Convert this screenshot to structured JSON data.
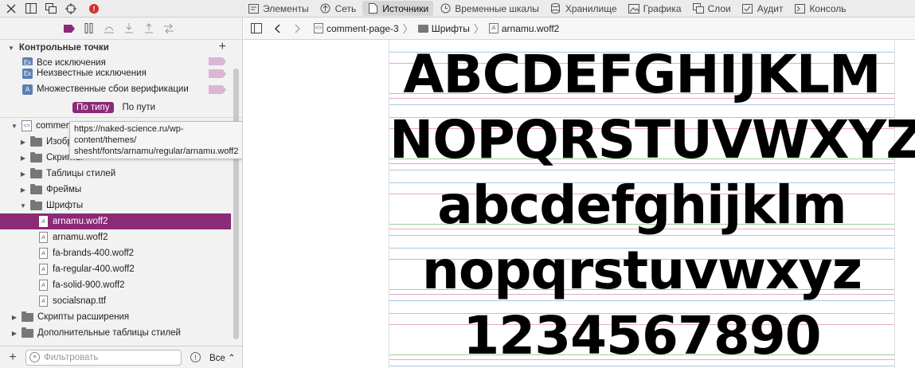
{
  "toolbar": {
    "icons": [
      "close-icon",
      "dock-icon",
      "undock-icon",
      "crosshair-icon"
    ],
    "error_badge": "!",
    "tabs": [
      {
        "label": "Элементы",
        "icon": "elements-icon",
        "active": false
      },
      {
        "label": "Сеть",
        "icon": "network-icon",
        "active": false
      },
      {
        "label": "Источники",
        "icon": "sources-icon",
        "active": true
      },
      {
        "label": "Временные шкалы",
        "icon": "timeline-icon",
        "active": false
      },
      {
        "label": "Хранилище",
        "icon": "storage-icon",
        "active": false
      },
      {
        "label": "Графика",
        "icon": "graphics-icon",
        "active": false
      },
      {
        "label": "Слои",
        "icon": "layers-icon",
        "active": false
      },
      {
        "label": "Аудит",
        "icon": "audit-icon",
        "active": false
      },
      {
        "label": "Консоль",
        "icon": "console-icon",
        "active": false
      }
    ]
  },
  "debugger": {
    "controls": [
      "breakpoints-toggle-icon",
      "pause-icon",
      "step-over-icon",
      "step-into-icon",
      "step-out-icon",
      "step-icon"
    ]
  },
  "breakpoints": {
    "title": "Контрольные точки",
    "items": [
      {
        "badge": "Ex",
        "label": "Все исключения"
      },
      {
        "badge": "Ex",
        "label": "Неизвестные исключения"
      },
      {
        "badge": "A",
        "label": "Множественные сбои верификации"
      }
    ]
  },
  "group_tabs": {
    "by_type": "По типу",
    "by_path": "По пути"
  },
  "tree": {
    "root": "comment-page-3",
    "root_short": "commen",
    "folders_top": [
      "Изображения",
      "Скрипты",
      "Таблицы стилей",
      "Фреймы"
    ],
    "fonts_folder": "Шрифты",
    "fonts": [
      {
        "label": "arnamu.woff2",
        "selected": true
      },
      {
        "label": "arnamu.woff2",
        "selected": false
      },
      {
        "label": "fa-brands-400.woff2",
        "selected": false
      },
      {
        "label": "fa-regular-400.woff2",
        "selected": false
      },
      {
        "label": "fa-solid-900.woff2",
        "selected": false
      },
      {
        "label": "socialsnap.ttf",
        "selected": false
      }
    ],
    "folders_bottom": [
      "Скрипты расширения",
      "Дополнительные таблицы стилей"
    ]
  },
  "tooltip": {
    "line1": "https://naked-science.ru/wp-content/themes/",
    "line2": "shesht/fonts/arnamu/regular/arnamu.woff2"
  },
  "filter": {
    "placeholder": "Фильтровать",
    "scope": "Все"
  },
  "breadcrumb": {
    "page": "comment-page-3",
    "folder": "Шрифты",
    "file": "arnamu.woff2"
  },
  "preview": {
    "rows": [
      "ABCDEFGHIJKLM",
      "NOPQRSTUVWXYZ",
      "abcdefghijklm",
      "nopqrstuvwxyz",
      "1234567890"
    ],
    "guide_colors": {
      "baseline": "#9ecf9e",
      "xheight": "#e6a8c8",
      "cap": "#a8c8e6"
    }
  }
}
